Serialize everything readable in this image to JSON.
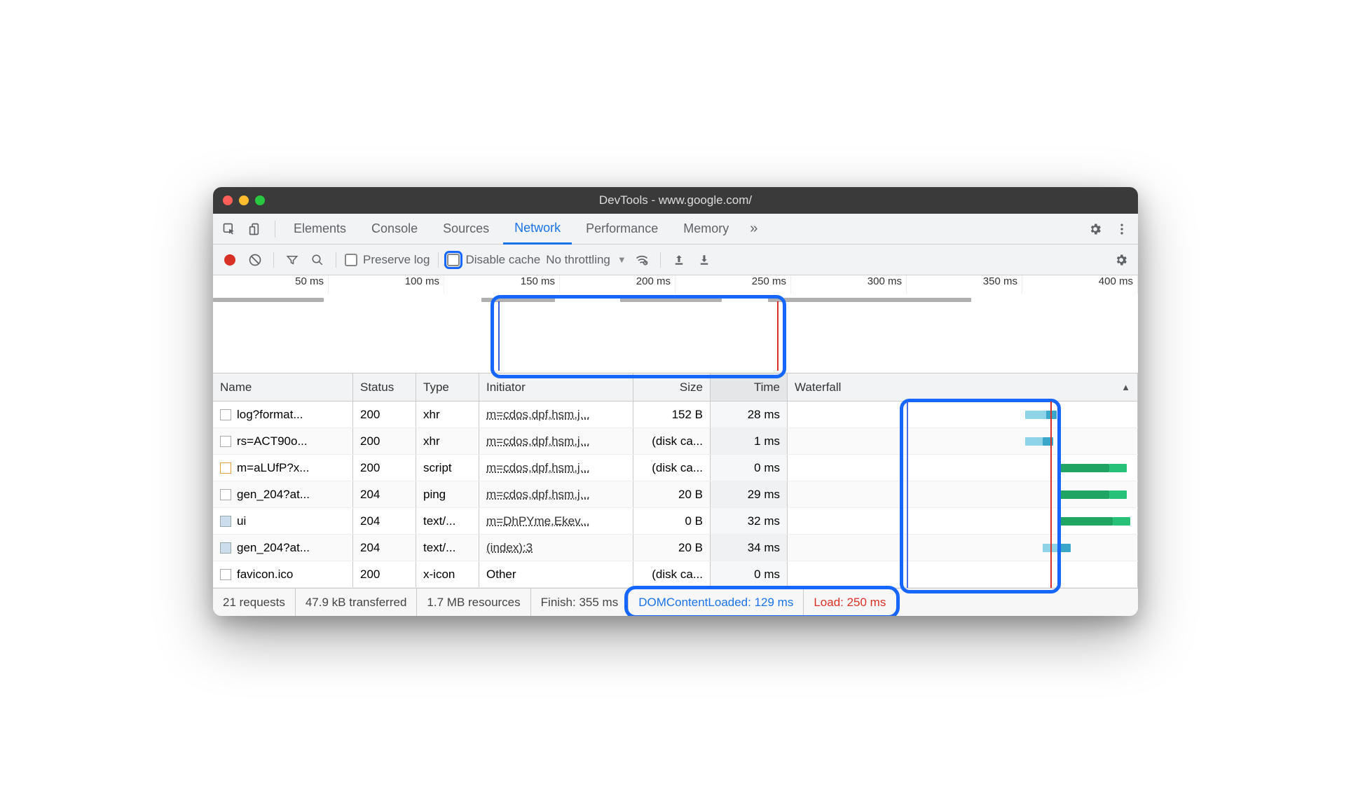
{
  "window": {
    "title": "DevTools - www.google.com/"
  },
  "tabs": [
    "Elements",
    "Console",
    "Sources",
    "Network",
    "Performance",
    "Memory"
  ],
  "tabs_active": "Network",
  "toolbar": {
    "preserve_log": "Preserve log",
    "disable_cache": "Disable cache",
    "throttling": "No throttling"
  },
  "overview": {
    "ticks": [
      "50 ms",
      "100 ms",
      "150 ms",
      "200 ms",
      "250 ms",
      "300 ms",
      "350 ms",
      "400 ms"
    ]
  },
  "columns": {
    "name": "Name",
    "status": "Status",
    "type": "Type",
    "initiator": "Initiator",
    "size": "Size",
    "time": "Time",
    "waterfall": "Waterfall"
  },
  "rows": [
    {
      "name": "log?format...",
      "status": "200",
      "type": "xhr",
      "initiator": "m=cdos,dpf,hsm,j...",
      "size": "152 B",
      "time": "28 ms",
      "icon": "doc"
    },
    {
      "name": "rs=ACT90o...",
      "status": "200",
      "type": "xhr",
      "initiator": "m=cdos,dpf,hsm,j...",
      "size": "(disk ca...",
      "time": "1 ms",
      "icon": "doc"
    },
    {
      "name": "m=aLUfP?x...",
      "status": "200",
      "type": "script",
      "initiator": "m=cdos,dpf,hsm,j...",
      "size": "(disk ca...",
      "time": "0 ms",
      "icon": "js"
    },
    {
      "name": "gen_204?at...",
      "status": "204",
      "type": "ping",
      "initiator": "m=cdos,dpf,hsm,j...",
      "size": "20 B",
      "time": "29 ms",
      "icon": "doc"
    },
    {
      "name": "ui",
      "status": "204",
      "type": "text/...",
      "initiator": "m=DhPYme,Ekev...",
      "size": "0 B",
      "time": "32 ms",
      "icon": "img"
    },
    {
      "name": "gen_204?at...",
      "status": "204",
      "type": "text/...",
      "initiator": "(index):3",
      "size": "20 B",
      "time": "34 ms",
      "icon": "img"
    },
    {
      "name": "favicon.ico",
      "status": "200",
      "type": "x-icon",
      "initiator": "Other",
      "size": "(disk ca...",
      "time": "0 ms",
      "icon": "doc",
      "plain": true
    }
  ],
  "status_bar": {
    "requests": "21 requests",
    "transferred": "47.9 kB transferred",
    "resources": "1.7 MB resources",
    "finish": "Finish: 355 ms",
    "dom": "DOMContentLoaded: 129 ms",
    "load": "Load: 250 ms"
  }
}
